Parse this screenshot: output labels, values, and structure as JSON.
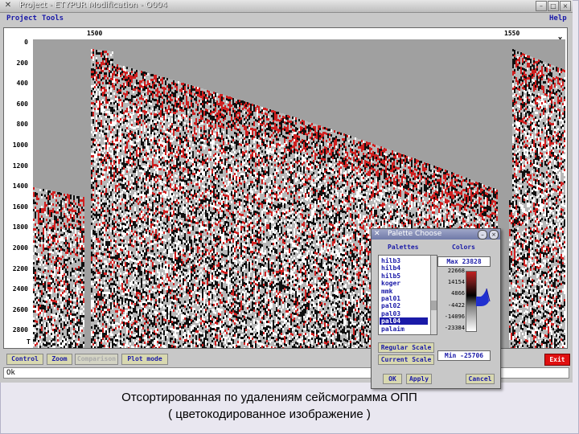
{
  "window": {
    "title": "Project - ETYPUR  Modification - O004",
    "minimize_glyph": "–",
    "maximize_glyph": "□",
    "close_glyph": "×",
    "app_icon_glyph": "✕"
  },
  "menubar": {
    "project": "Project",
    "tools": "Tools",
    "help": "Help"
  },
  "plot": {
    "x_ticks": [
      "1500",
      "1550"
    ],
    "x_axis_mark": "X",
    "t_axis_mark": "T",
    "y_ticks": [
      "0",
      "200",
      "400",
      "600",
      "800",
      "1000",
      "1200",
      "1400",
      "1600",
      "1800",
      "2000",
      "2200",
      "2400",
      "2600",
      "2800"
    ]
  },
  "buttons": {
    "control": "Control",
    "zoom": "Zoom",
    "comparison": "Comparison",
    "plot_mode": "Plot mode",
    "exit": "Exit"
  },
  "status": {
    "text": "Ok"
  },
  "palette_dialog": {
    "title": "Palette Choose",
    "palettes_label": "Palettes",
    "colors_label": "Colors",
    "palettes": [
      "hilb3",
      "hilb4",
      "hilb5",
      "koger",
      "mmk",
      "pal01",
      "pal02",
      "pal03",
      "pal04",
      "palaim"
    ],
    "selected_palette": "pal04",
    "max_label": "Max 23828",
    "min_label": "Min -25706",
    "color_ticks": [
      "22668",
      "14154",
      "4866",
      "-4422",
      "-14096",
      "-23384"
    ],
    "regular_scale": "Regular Scale",
    "current_scale": "Current Scale",
    "ok": "OK",
    "apply": "Apply",
    "cancel": "Cancel"
  },
  "caption": {
    "line1": "Отсортированная по удалениям сейсмограмма ОПП",
    "line2": "(  цветокодированное изображение )"
  }
}
